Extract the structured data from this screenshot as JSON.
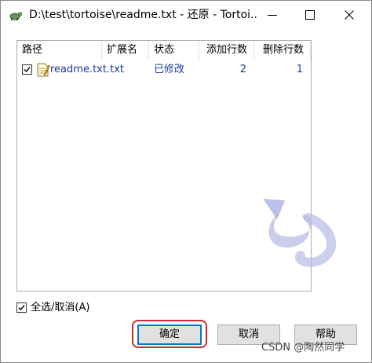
{
  "window": {
    "title": "D:\\test\\tortoise\\readme.txt - 还原 - Tortoi..."
  },
  "colors": {
    "link_blue": "#1a3a9c",
    "focus_blue": "#0078d7",
    "highlight_red": "#d22a2a"
  },
  "columns": {
    "path": "路径",
    "extension": "扩展名",
    "status": "状态",
    "added_lines": "添加行数",
    "deleted_lines": "删除行数"
  },
  "rows": [
    {
      "path": "readme.txt",
      "extension": ".txt",
      "status": "已修改",
      "added_lines": "2",
      "deleted_lines": "1"
    }
  ],
  "select_all": {
    "label": "全选/取消(A)"
  },
  "buttons": {
    "ok": "确定",
    "cancel": "取消",
    "help": "帮助"
  },
  "watermark_text": "CSDN @陶然同学"
}
